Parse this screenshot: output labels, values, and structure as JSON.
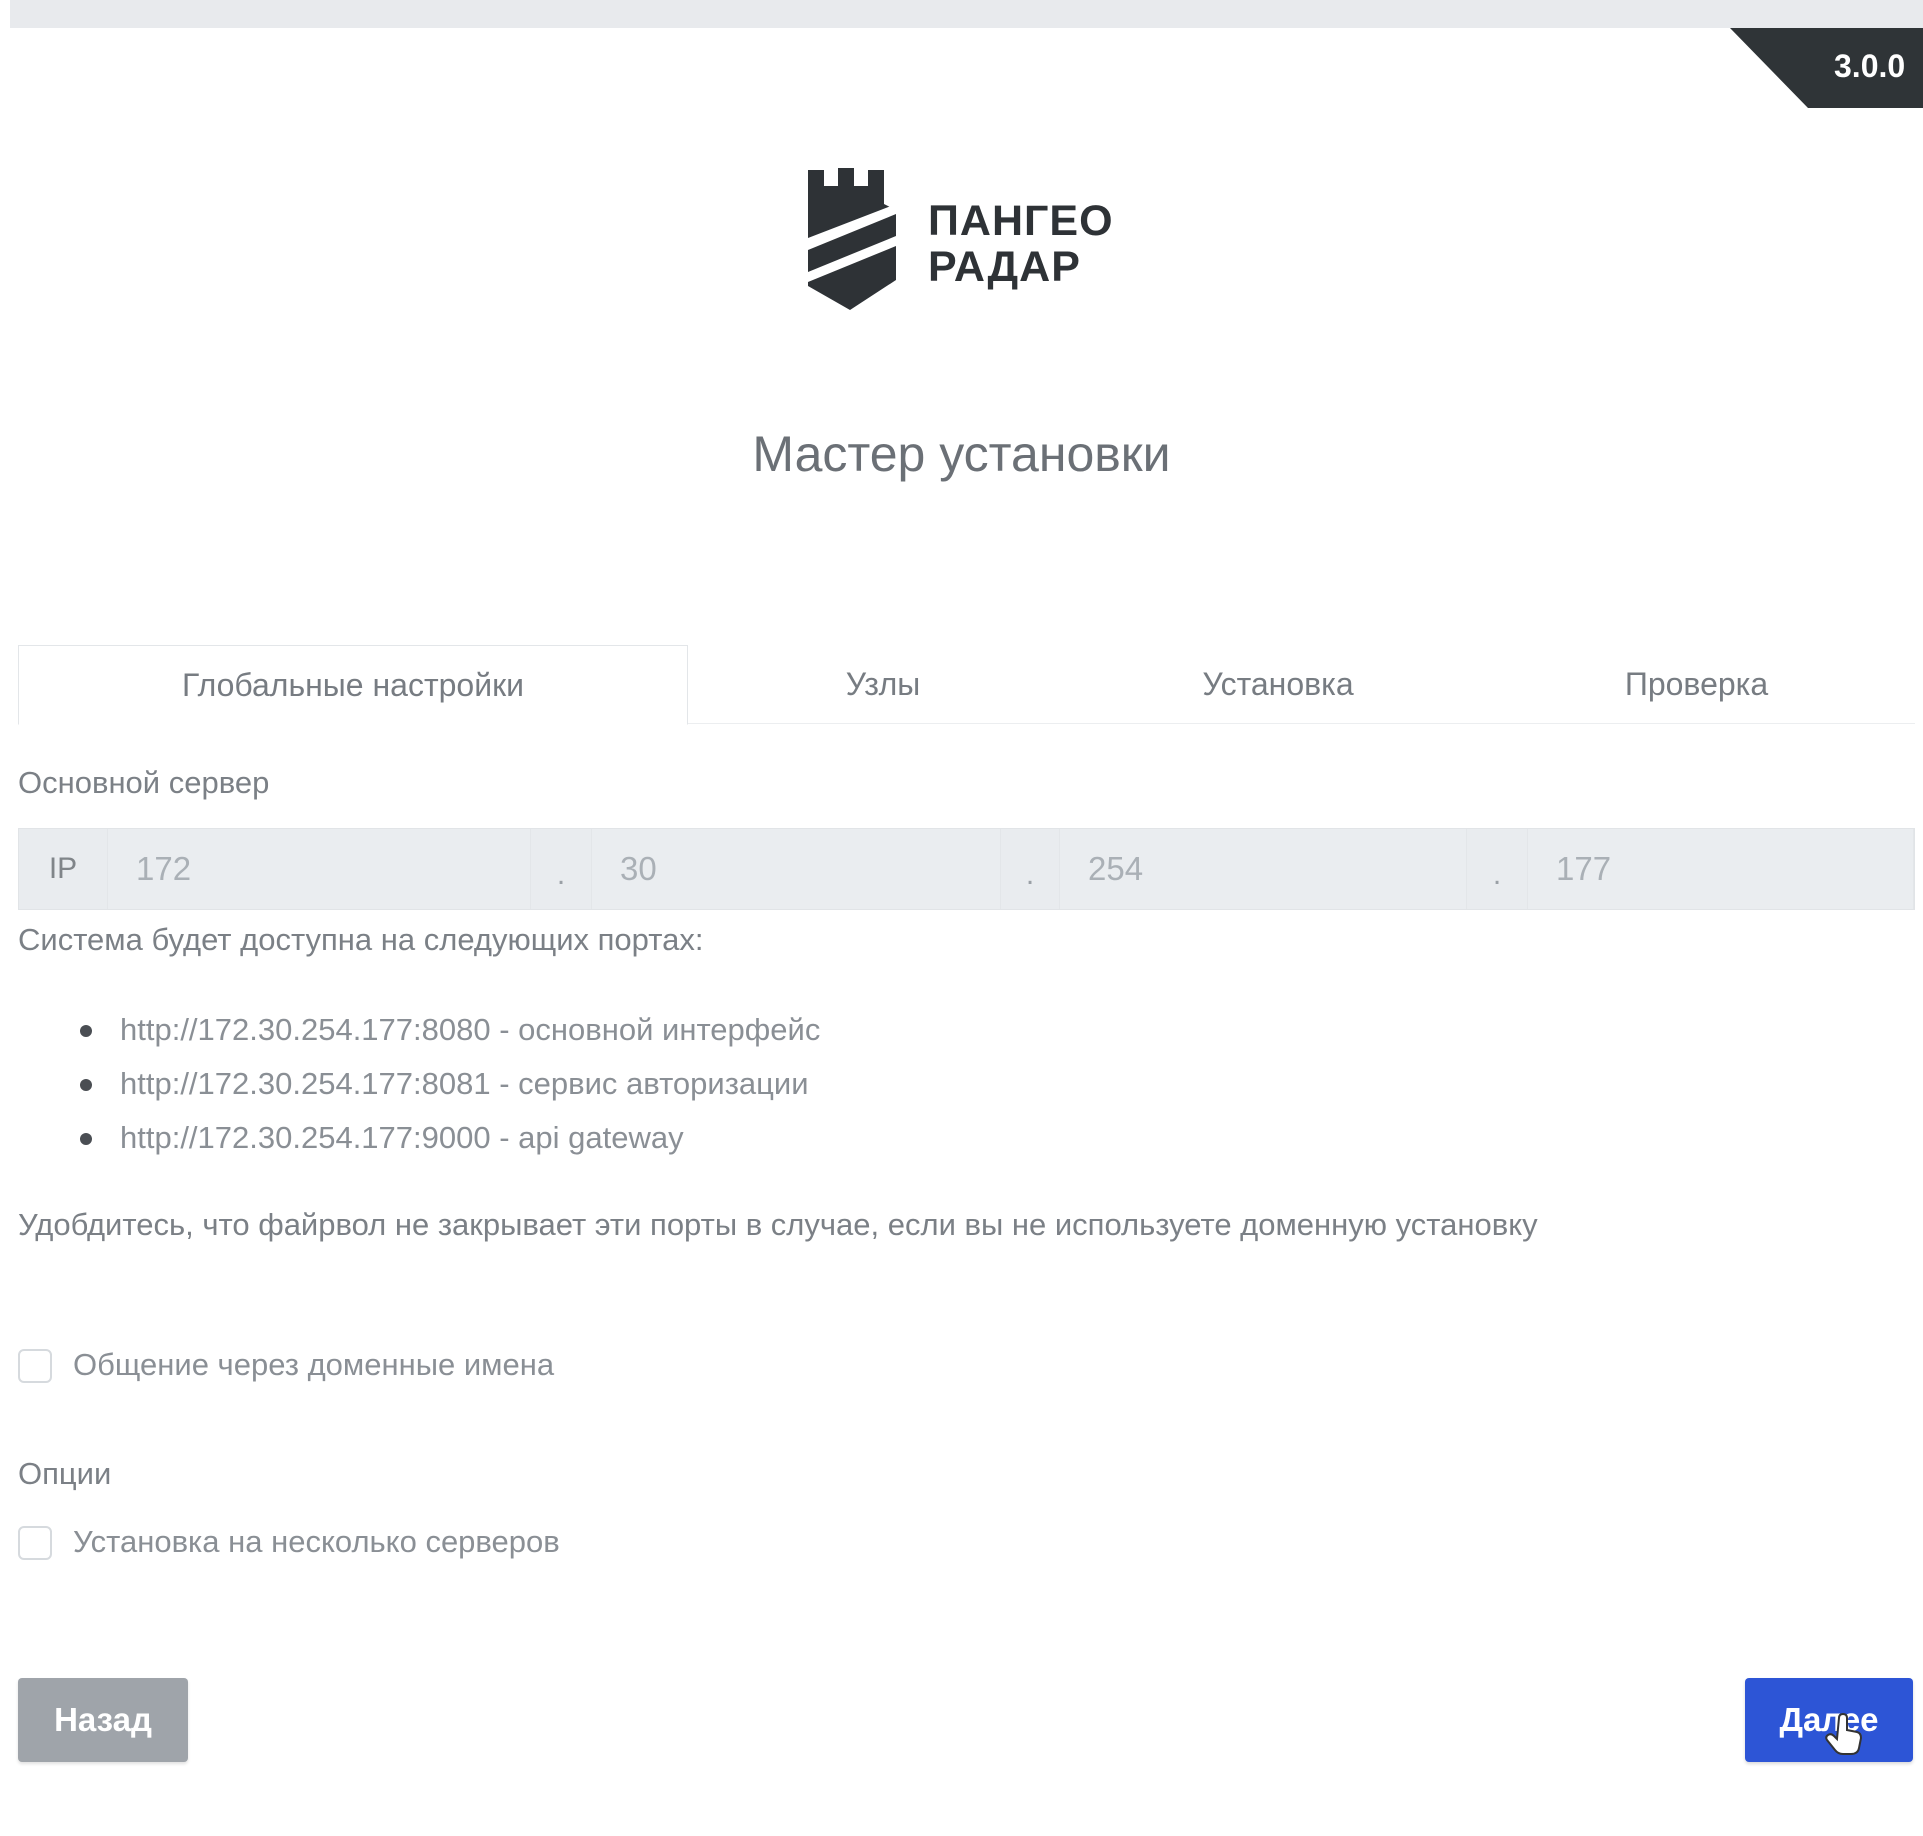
{
  "header": {
    "version": "3.0.0"
  },
  "logo": {
    "line1": "ПАНГЕО",
    "line2": "РАДАР"
  },
  "wizard": {
    "title": "Мастер установки"
  },
  "tabs": [
    {
      "label": "Глобальные настройки",
      "active": true
    },
    {
      "label": "Узлы",
      "active": false
    },
    {
      "label": "Установка",
      "active": false
    },
    {
      "label": "Проверка",
      "active": false
    }
  ],
  "main_server": {
    "section_label": "Основной сервер",
    "ip_prefix": "IP",
    "octets": [
      "172",
      "30",
      "254",
      "177"
    ],
    "separator": "."
  },
  "ports": {
    "intro": "Система будет доступна на следующих портах:",
    "items": [
      "http://172.30.254.177:8080 - основной интерфейс",
      "http://172.30.254.177:8081 - сервис авторизации",
      "http://172.30.254.177:9000 - api gateway"
    ],
    "firewall_note": "Удобдитесь, что файрвол не закрывает эти порты в случае, если вы не используете доменную установку"
  },
  "domain_option": {
    "label": "Общение через доменные имена",
    "checked": false
  },
  "options": {
    "section_label": "Опции",
    "multi_server_label": "Установка на несколько серверов",
    "multi_server_checked": false
  },
  "buttons": {
    "back": "Назад",
    "next": "Далее"
  },
  "colors": {
    "primary_button": "#2d55d6",
    "secondary_button": "#9fa4aa",
    "version_ribbon": "#2f3437"
  }
}
